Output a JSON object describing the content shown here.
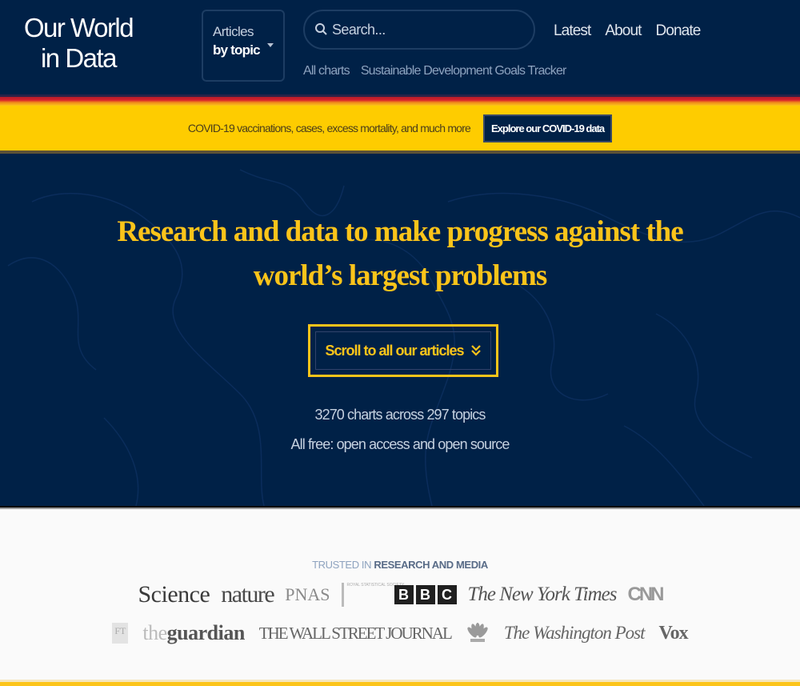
{
  "nav": {
    "logo_line1": "Our World",
    "logo_line2": "in Data",
    "topics_line1": "Articles",
    "topics_line2": "by topic",
    "search_placeholder": "Search...",
    "sublinks": [
      "All charts",
      "Sustainable Development Goals Tracker"
    ],
    "mainlinks": [
      "Latest",
      "About",
      "Donate"
    ]
  },
  "banner": {
    "text": "COVID-19 vaccinations, cases, excess mortality, and much more",
    "button": "Explore our COVID-19 data"
  },
  "hero": {
    "title": "Research and data to make progress against the world’s largest problems",
    "scroll_button": "Scroll to all our articles",
    "stats_line1": "3270 charts across 297 topics",
    "stats_line2": "All free: open access and open source"
  },
  "trusted": {
    "heading_light": "TRUSTED IN",
    "heading_bold": "RESEARCH AND MEDIA",
    "logos_row1": [
      "Science",
      "nature",
      "PNAS",
      "Royal Statistical Society",
      "BBC",
      "The New York Times",
      "CNN"
    ],
    "logos_row2": [
      "FT",
      "the guardian",
      "THE WALL STREET JOURNAL",
      "NBC",
      "The Washington Post",
      "Vox"
    ],
    "rss_text": "ROYAL STATISTICAL SOCIETY",
    "bbc_letters": [
      "B",
      "B",
      "C"
    ],
    "guardian_the": "the",
    "guardian_main": "guardian"
  },
  "colors": {
    "navy": "#002147",
    "gold": "#fbc41a",
    "banner_yellow": "#fecc00"
  }
}
